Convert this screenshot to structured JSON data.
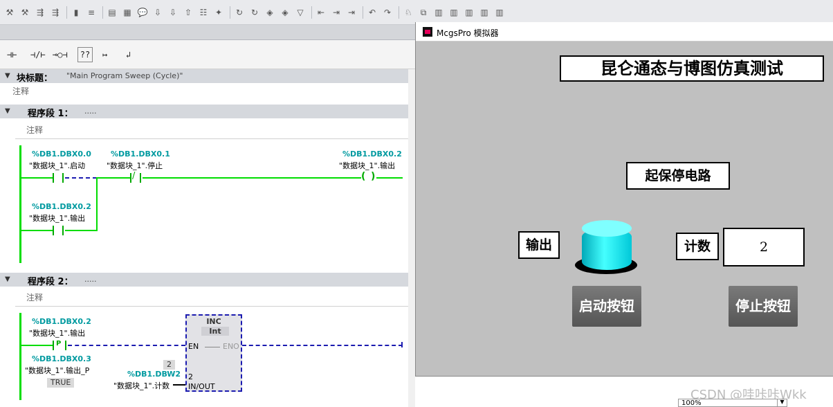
{
  "toolbar_icons": [
    "network-icon",
    "delete-network-icon",
    "insert-icon",
    "insert-row-icon",
    "connect-icon",
    "go-online-icon",
    "block-icon",
    "interface-icon",
    "list-icon",
    "comment-icon",
    "monitor-icon",
    "download-icon",
    "upload-icon",
    "compile-icon",
    "watch-icon",
    "favorites-icon",
    "breakpoint-icon",
    "step-icon",
    "run-icon",
    "refresh-icon",
    "config-icon",
    "connect-online-icon",
    "disconnect-icon",
    "jump-icon",
    "edit-icon",
    "nav-icon",
    "call-icon",
    "return-icon",
    "user-icon",
    "simulate-icon",
    "db-icon"
  ],
  "ladder_toolbar": {
    "no_contact": "⊣⊢",
    "nc_contact": "⊣/⊢",
    "coil": "⊸○⊣",
    "box": "??",
    "branch_open": "↦",
    "branch_close": "↲"
  },
  "block_title": {
    "label": "块标题：",
    "value": "\"Main Program Sweep (Cycle)\""
  },
  "comment_label": "注释",
  "network1": {
    "title": "程序段 1：",
    "dots": ".....",
    "comment": "注释",
    "c1_addr": "%DB1.DBX0.0",
    "c1_tag": "\"数据块_1\".启动",
    "c2_addr": "%DB1.DBX0.1",
    "c2_tag": "\"数据块_1\".停止",
    "coil_addr": "%DB1.DBX0.2",
    "coil_tag": "\"数据块_1\".输出",
    "c3_addr": "%DB1.DBX0.2",
    "c3_tag": "\"数据块_1\".输出"
  },
  "network2": {
    "title": "程序段 2：",
    "dots": ".....",
    "comment": "注释",
    "p_addr": "%DB1.DBX0.2",
    "p_tag": "\"数据块_1\".输出",
    "p_label": "P",
    "edge_addr": "%DB1.DBX0.3",
    "edge_tag": "\"数据块_1\".输出_P",
    "edge_value": "TRUE",
    "fb_name": "INC",
    "fb_type": "Int",
    "en": "EN",
    "eno": "ENO",
    "inout_value_outer": "2",
    "inout_value_inner": "2",
    "inout_pin": "IN/OUT",
    "inout_addr": "%DB1.DBW2",
    "inout_tag": "\"数据块_1\".计数"
  },
  "simulator": {
    "title": "McgsPro 模拟器",
    "heading": "昆仑通态与博图仿真测试",
    "subtitle": "起保停电路",
    "output_label": "输出",
    "count_label": "计数",
    "count_value": "2",
    "start_button": "启动按钮",
    "stop_button": "停止按钮",
    "lamp_on": true,
    "colors": {
      "background": "#c0c0c0",
      "lamp": "#00ffff",
      "button": "#666666"
    }
  },
  "watermark": "CSDN @哇咔咔Wkk",
  "zoom": "100%"
}
